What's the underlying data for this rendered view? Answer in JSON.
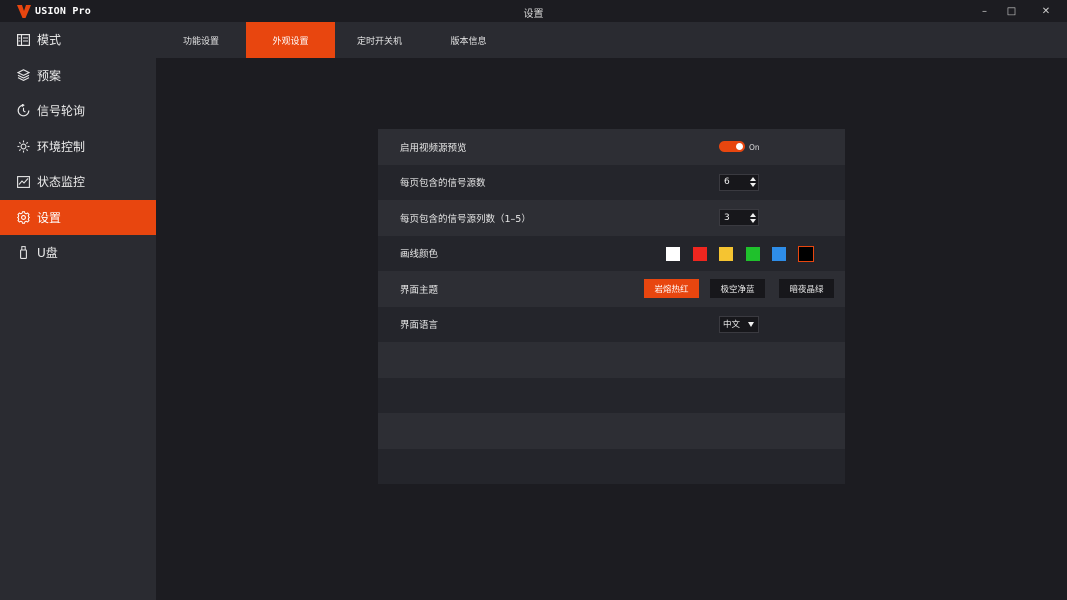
{
  "app": {
    "logo_text": "USION Pro",
    "window_title": "设置",
    "window_controls": {
      "minimize": "–",
      "maximize": "□",
      "close": "✕"
    },
    "accent_color": "#e8460f"
  },
  "sidebar": {
    "items": [
      {
        "label": "模式",
        "icon": "mode-icon"
      },
      {
        "label": "预案",
        "icon": "layers-icon"
      },
      {
        "label": "信号轮询",
        "icon": "polling-icon"
      },
      {
        "label": "环境控制",
        "icon": "sun-icon"
      },
      {
        "label": "状态监控",
        "icon": "chart-icon"
      },
      {
        "label": "设置",
        "icon": "gear-icon",
        "active": true
      },
      {
        "label": "U盘",
        "icon": "usb-icon"
      }
    ]
  },
  "tabs": [
    {
      "label": "功能设置"
    },
    {
      "label": "外观设置",
      "active": true
    },
    {
      "label": "定时开关机"
    },
    {
      "label": "版本信息"
    }
  ],
  "settings": {
    "preview": {
      "label": "启用视频源预览",
      "state": "On",
      "enabled": true
    },
    "sources_per_page": {
      "label": "每页包含的信号源数",
      "value": "6"
    },
    "columns_per_page": {
      "label": "每页包含的信号源列数（1–5）",
      "value": "3"
    },
    "line_color": {
      "label": "画线颜色",
      "colors": [
        "#ffffff",
        "#f0261f",
        "#f5c431",
        "#1fc12c",
        "#2e8de8",
        "#000000"
      ],
      "selected_index": 5
    },
    "theme": {
      "label": "界面主题",
      "options": [
        "岩熔热红",
        "极空净蓝",
        "暗夜晶绿"
      ],
      "selected_index": 0
    },
    "language": {
      "label": "界面语言",
      "value": "中文"
    }
  }
}
